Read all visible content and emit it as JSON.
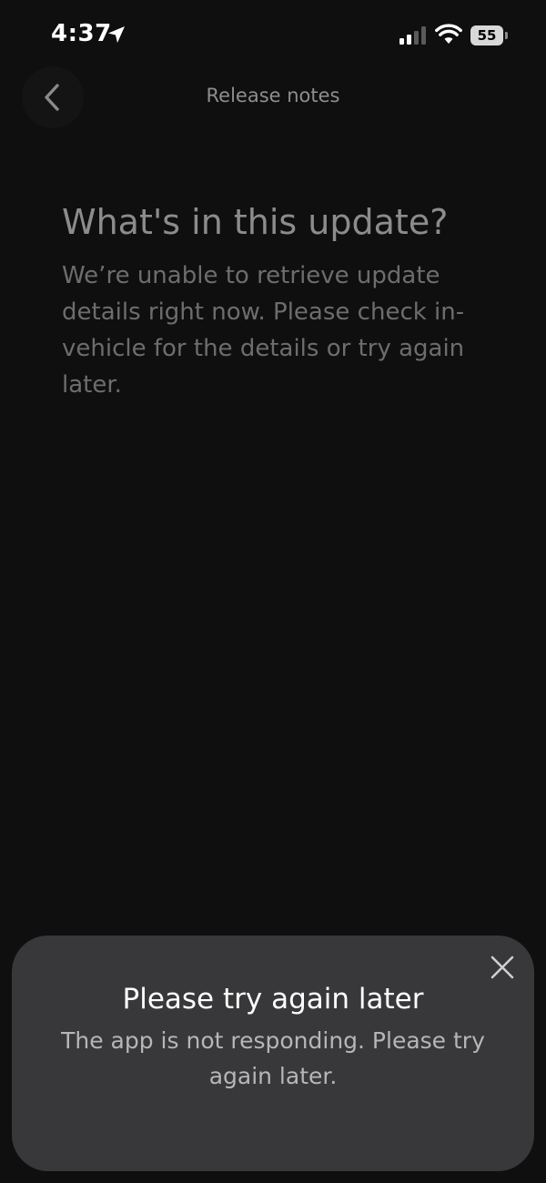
{
  "status_bar": {
    "time": "4:37",
    "battery_level": "55",
    "icons": [
      "location-arrow-icon",
      "cellular-signal-icon",
      "wifi-icon",
      "battery-icon"
    ]
  },
  "header": {
    "title": "Release notes",
    "back_icon": "chevron-left-icon"
  },
  "content": {
    "heading": "What's in this update?",
    "body": "We’re unable to retrieve update details right now. Please check in-vehicle for the details or try again later."
  },
  "toast": {
    "title": "Please try again later",
    "message": "The app is not responding. Please try again later.",
    "close_icon": "close-icon"
  },
  "colors": {
    "background": "#0f0f10",
    "toast_background": "#38383a",
    "heading_text": "#8c8c8c",
    "body_text": "#6d6d6d"
  }
}
